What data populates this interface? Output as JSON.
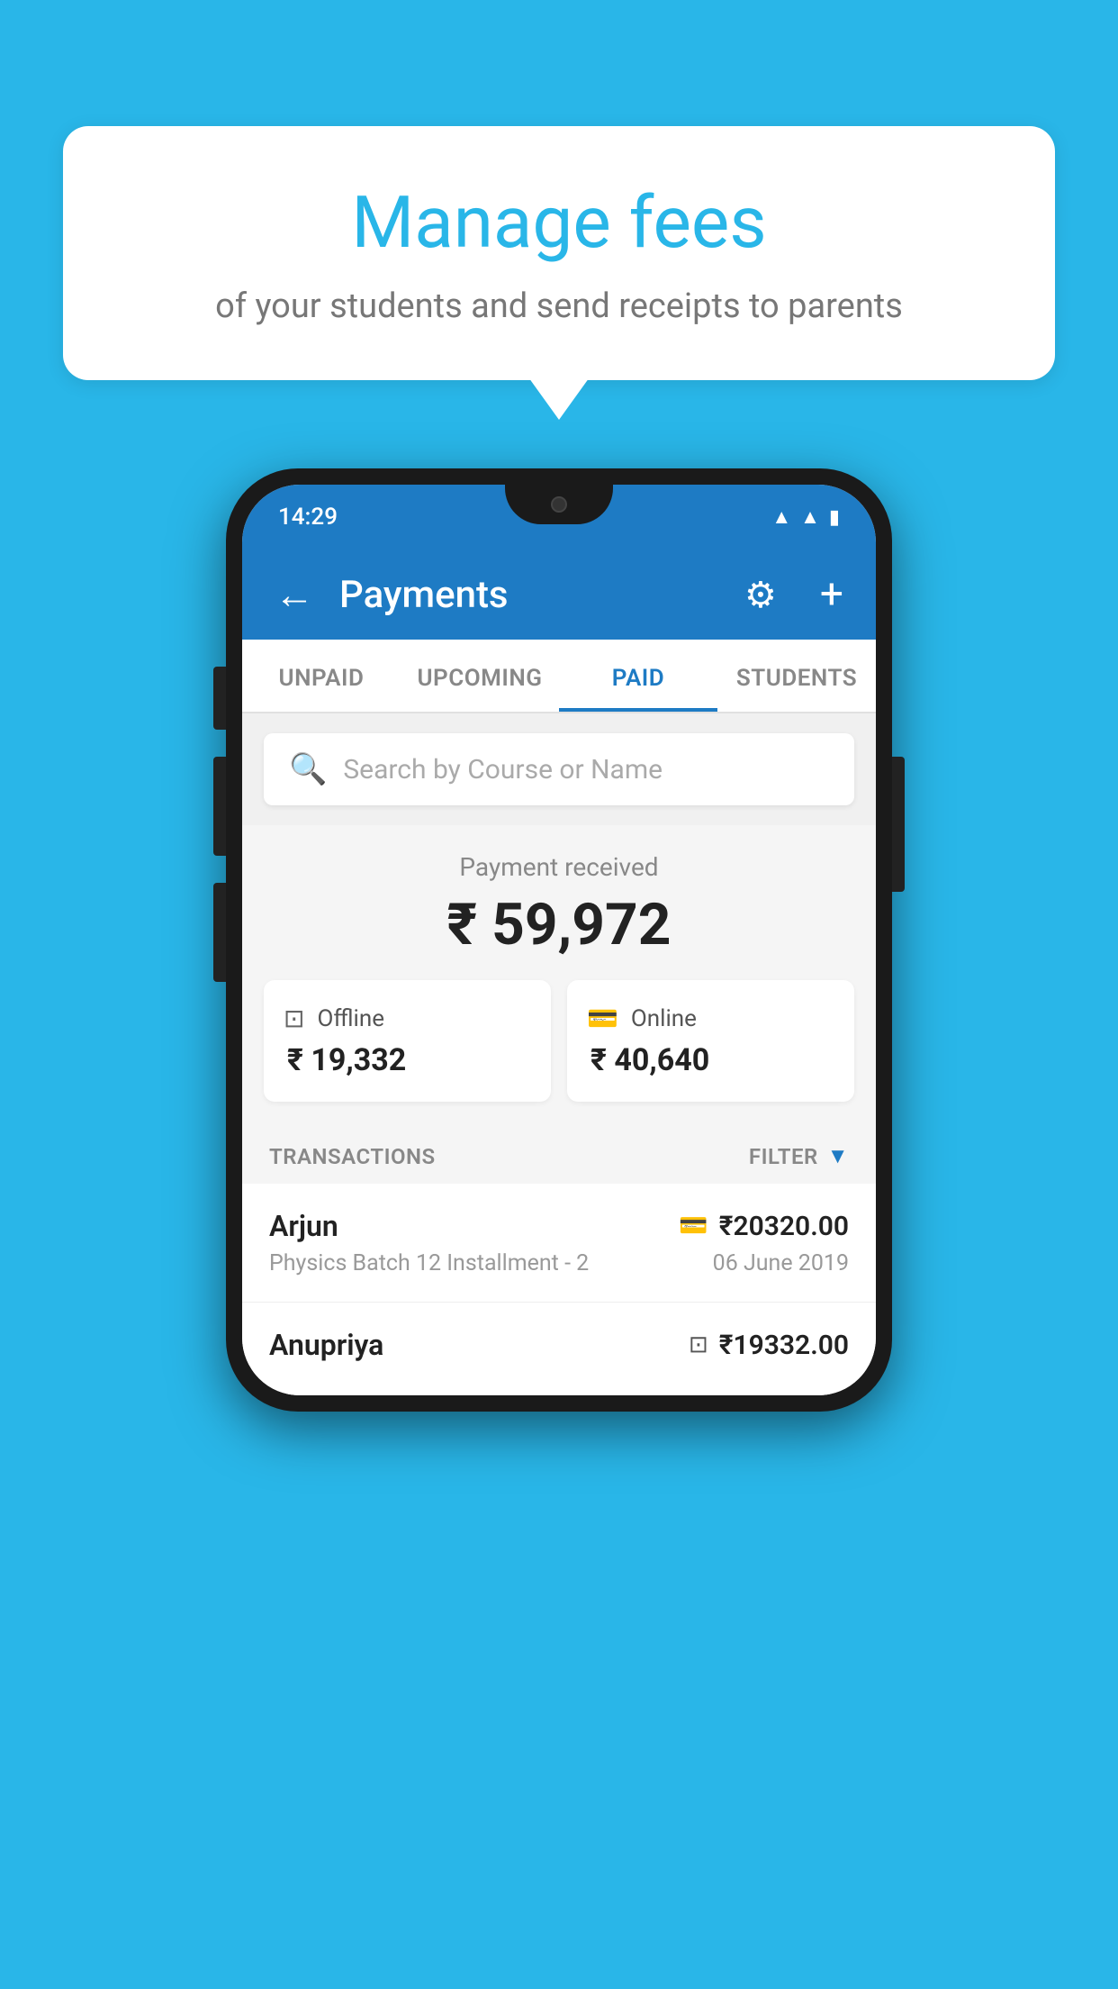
{
  "background_color": "#29b6e8",
  "speech_bubble": {
    "title": "Manage fees",
    "subtitle": "of your students and send receipts to parents"
  },
  "phone": {
    "status_bar": {
      "time": "14:29"
    },
    "header": {
      "title": "Payments",
      "back_label": "←",
      "settings_icon": "gear-icon",
      "add_icon": "plus-icon"
    },
    "tabs": [
      {
        "label": "UNPAID",
        "active": false
      },
      {
        "label": "UPCOMING",
        "active": false
      },
      {
        "label": "PAID",
        "active": true
      },
      {
        "label": "STUDENTS",
        "active": false
      }
    ],
    "search": {
      "placeholder": "Search by Course or Name"
    },
    "payment_summary": {
      "label": "Payment received",
      "amount": "₹ 59,972",
      "offline": {
        "label": "Offline",
        "amount": "₹ 19,332"
      },
      "online": {
        "label": "Online",
        "amount": "₹ 40,640"
      }
    },
    "transactions_section": {
      "label": "TRANSACTIONS",
      "filter_label": "FILTER",
      "rows": [
        {
          "name": "Arjun",
          "amount": "₹20320.00",
          "payment_type": "online",
          "detail": "Physics Batch 12 Installment - 2",
          "date": "06 June 2019"
        },
        {
          "name": "Anupriya",
          "amount": "₹19332.00",
          "payment_type": "offline",
          "detail": "",
          "date": ""
        }
      ]
    }
  }
}
